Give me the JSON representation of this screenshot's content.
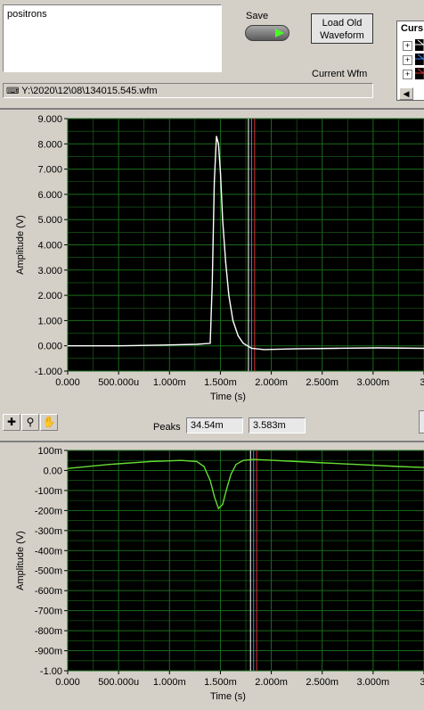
{
  "notes": {
    "text": "positrons"
  },
  "save": {
    "label": "Save"
  },
  "load": {
    "label": "Load Old Waveform"
  },
  "current_wfm": {
    "label": "Current Wfm",
    "path": "Y:\\2020\\12\\08\\134015.545.wfm"
  },
  "cursor_panel": {
    "title": "Curs",
    "expand": "+"
  },
  "peaks": {
    "label": "Peaks",
    "value1": "34.54m",
    "value2": "3.583m"
  },
  "colors": {
    "plot_bg": "#000000",
    "grid": "#1a6b1a",
    "trace_top": "#ffffff",
    "trace_bottom": "#66dd33",
    "cursor_blue": "#3a8cff",
    "cursor_red": "#e03030",
    "cursor_white": "#ffffff"
  },
  "chart_data": [
    {
      "type": "line",
      "xlabel": "Time (s)",
      "ylabel": "Amplitude (V)",
      "xlim": [
        0,
        0.00345
      ],
      "ylim": [
        -1.0,
        9.0
      ],
      "x_ticks": [
        "0.000",
        "500.000u",
        "1.000m",
        "1.500m",
        "2.000m",
        "2.500m",
        "3.000m",
        "3."
      ],
      "y_ticks": [
        "9.000",
        "8.000",
        "7.000",
        "6.000",
        "5.000",
        "4.000",
        "3.000",
        "2.000",
        "1.000",
        "0.000",
        "-1.000"
      ],
      "series": [
        {
          "x": [
            0,
            0.0005,
            0.0009,
            0.00125,
            0.00138,
            0.0014,
            0.00142,
            0.00144,
            0.00146,
            0.00148,
            0.0015,
            0.00153,
            0.00156,
            0.0016,
            0.00165,
            0.0017,
            0.00178,
            0.0019,
            0.0022,
            0.0026,
            0.003,
            0.00345
          ],
          "y": [
            0.0,
            0.0,
            0.03,
            0.06,
            0.1,
            2.5,
            6.5,
            8.3,
            8.0,
            6.8,
            5.0,
            3.3,
            2.0,
            1.0,
            0.4,
            0.1,
            -0.1,
            -0.15,
            -0.12,
            -0.1,
            -0.08,
            -0.1
          ]
        }
      ],
      "cursors_x": [
        0.00175,
        0.00178,
        0.00181
      ]
    },
    {
      "type": "line",
      "xlabel": "Time (s)",
      "ylabel": "Amplitude (V)",
      "xlim": [
        0,
        0.00345
      ],
      "ylim": [
        -1.0,
        0.1
      ],
      "x_ticks": [
        "0.000",
        "500.000u",
        "1.000m",
        "1.500m",
        "2.000m",
        "2.500m",
        "3.000m",
        "3."
      ],
      "y_ticks": [
        "100m",
        "0.00",
        "-100m",
        "-200m",
        "-300m",
        "-400m",
        "-500m",
        "-600m",
        "-700m",
        "-800m",
        "-900m",
        "-1.00"
      ],
      "series": [
        {
          "x": [
            0,
            0.0004,
            0.0008,
            0.0011,
            0.00125,
            0.00132,
            0.00138,
            0.00142,
            0.00146,
            0.0015,
            0.00154,
            0.00158,
            0.00163,
            0.0017,
            0.0018,
            0.002,
            0.0024,
            0.0028,
            0.0032,
            0.00345
          ],
          "y": [
            0.01,
            0.03,
            0.045,
            0.05,
            0.045,
            0.02,
            -0.05,
            -0.13,
            -0.19,
            -0.17,
            -0.09,
            -0.02,
            0.03,
            0.05,
            0.055,
            0.05,
            0.04,
            0.03,
            0.02,
            0.015
          ]
        }
      ],
      "cursors_x": [
        0.00177,
        0.0018,
        0.00183
      ]
    }
  ]
}
